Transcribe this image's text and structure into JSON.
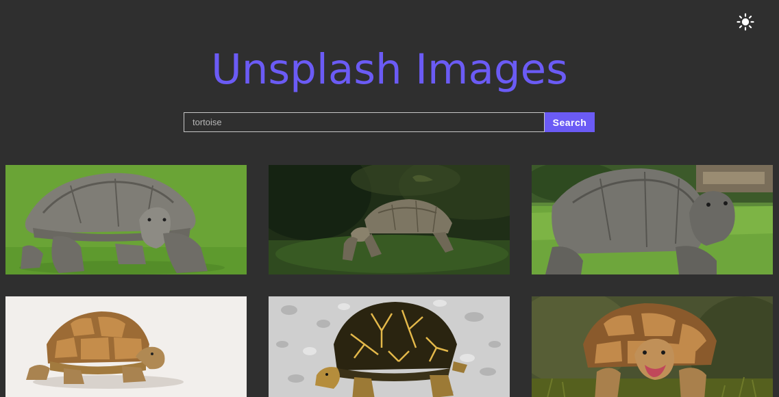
{
  "header": {
    "title": "Unsplash Images",
    "theme_toggle_icon": "sun-icon"
  },
  "search": {
    "value": "tortoise",
    "placeholder": "",
    "button_label": "Search"
  },
  "colors": {
    "background": "#2f2f2f",
    "accent": "#6b5bf5",
    "input_border": "#c8c8c8"
  },
  "results": [
    {
      "subject": "giant tortoise on green lawn"
    },
    {
      "subject": "tortoise walking in dark grass"
    },
    {
      "subject": "giant tortoise in sunny park"
    },
    {
      "subject": "sulcata tortoise on white background"
    },
    {
      "subject": "star tortoise on gravel"
    },
    {
      "subject": "tortoise eating in grass"
    }
  ]
}
